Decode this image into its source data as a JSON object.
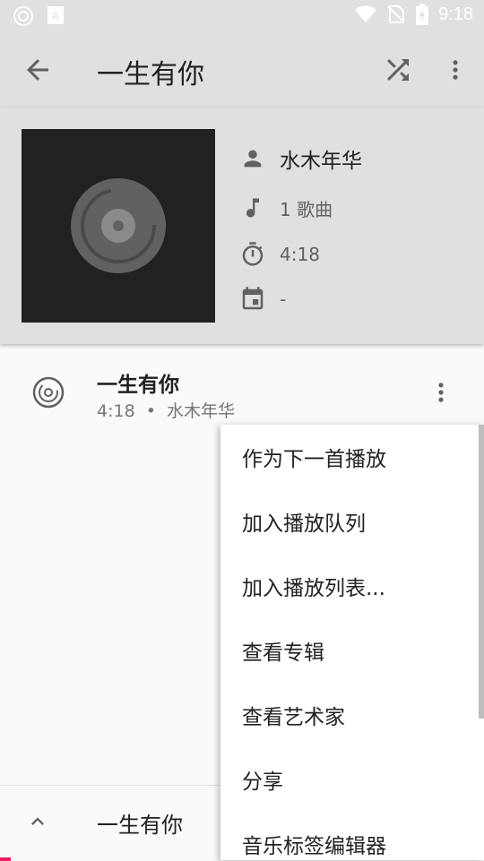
{
  "status_bar": {
    "time": "9:18",
    "icons": [
      "sync-icon",
      "keyboard-icon",
      "wifi-icon",
      "no-sim-icon",
      "battery-icon"
    ]
  },
  "app_bar": {
    "title": "一生有你",
    "icons": [
      "back-arrow-icon",
      "shuffle-icon",
      "more-vert-icon"
    ]
  },
  "album": {
    "artist": "水木年华",
    "song_count": "1 歌曲",
    "duration": "4:18",
    "year": "-"
  },
  "songs": [
    {
      "title": "一生有你",
      "duration": "4:18",
      "separator": "•",
      "artist": "水木年华"
    }
  ],
  "menu": {
    "items": [
      "作为下一首播放",
      "加入播放队列",
      "加入播放列表...",
      "查看专辑",
      "查看艺术家",
      "分享",
      "音乐标签编辑器"
    ]
  },
  "mini_player": {
    "title": "一生有你"
  },
  "colors": {
    "header_bg": "#e0e0e0",
    "cover_bg": "#212121",
    "accent": "#e91e63"
  }
}
